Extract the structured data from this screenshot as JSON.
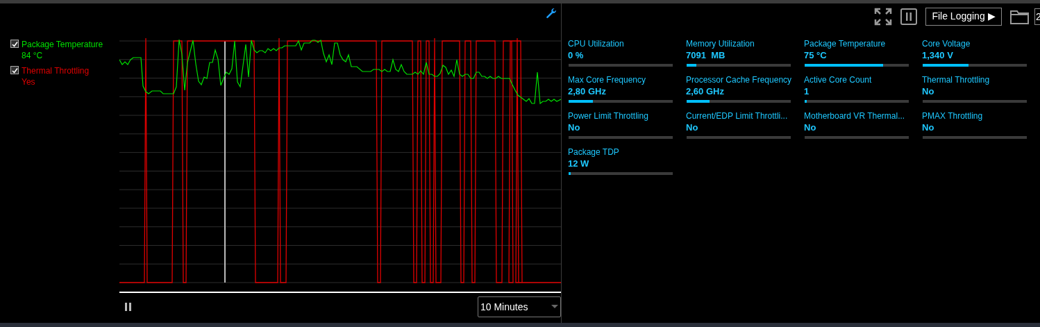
{
  "legend": [
    {
      "label": "Package Temperature",
      "value": "84 °C",
      "color": "#00e000",
      "checked": true
    },
    {
      "label": "Thermal Throttling",
      "value": "Yes",
      "color": "#e00000",
      "checked": true
    }
  ],
  "chart_controls": {
    "time_range": "10 Minutes"
  },
  "toolbar": {
    "file_logging": "File Logging ▶",
    "cut_field": "2"
  },
  "metrics": [
    {
      "label": "CPU Utilization",
      "value": "0 %",
      "level": 0
    },
    {
      "label": "Memory Utilization",
      "value": "7091  MB",
      "level": 0.09
    },
    {
      "label": "Package Temperature",
      "value": "75 °C",
      "level": 0.75
    },
    {
      "label": "Core Voltage",
      "value": "1,340 V",
      "level": 0.44
    },
    {
      "label": "Max Core Frequency",
      "value": "2,80 GHz",
      "level": 0.23
    },
    {
      "label": "Processor Cache Frequency",
      "value": "2,60 GHz",
      "level": 0.22
    },
    {
      "label": "Active Core Count",
      "value": "1",
      "level": 0.02
    },
    {
      "label": "Thermal Throttling",
      "value": "No",
      "level": 0
    },
    {
      "label": "Power Limit Throttling",
      "value": "No",
      "level": 0
    },
    {
      "label": "Current/EDP Limit Throttli...",
      "value": "No",
      "level": 0
    },
    {
      "label": "Motherboard VR Thermal...",
      "value": "No",
      "level": 0
    },
    {
      "label": "PMAX Throttling",
      "value": "No",
      "level": 0
    },
    {
      "label": "Package TDP",
      "value": "12 W",
      "level": 0.02
    }
  ]
}
